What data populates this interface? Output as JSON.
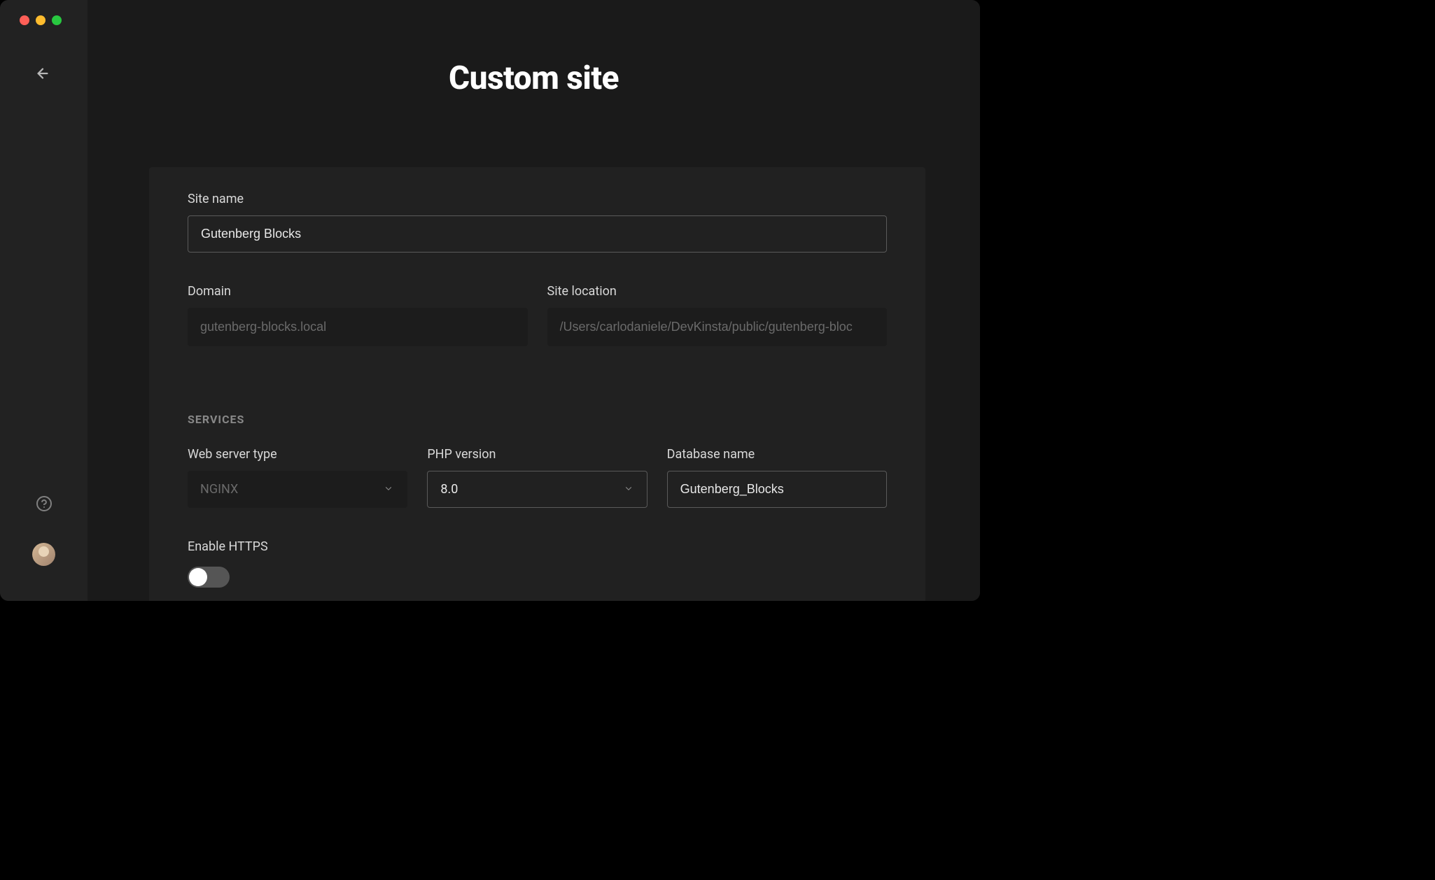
{
  "header": {
    "title": "Custom site"
  },
  "form": {
    "site_name": {
      "label": "Site name",
      "value": "Gutenberg Blocks"
    },
    "domain": {
      "label": "Domain",
      "value": "gutenberg-blocks.local"
    },
    "site_location": {
      "label": "Site location",
      "value": "/Users/carlodaniele/DevKinsta/public/gutenberg-bloc"
    },
    "services": {
      "header": "SERVICES",
      "web_server": {
        "label": "Web server type",
        "value": "NGINX"
      },
      "php_version": {
        "label": "PHP version",
        "value": "8.0"
      },
      "database_name": {
        "label": "Database name",
        "value": "Gutenberg_Blocks"
      },
      "enable_https": {
        "label": "Enable HTTPS",
        "value": false
      }
    }
  }
}
